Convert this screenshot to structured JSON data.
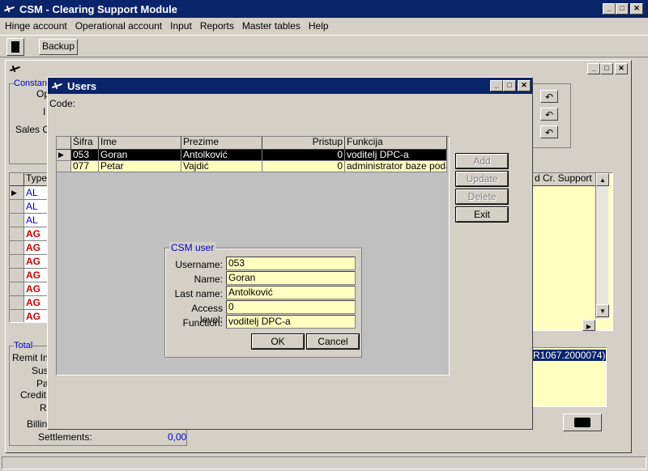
{
  "app": {
    "title": "CSM - Clearing Support Module",
    "menu": [
      "Hinge account",
      "Operational account",
      "Input",
      "Reports",
      "Master tables",
      "Help"
    ],
    "toolbar_backup_label": "Backup"
  },
  "bg_window": {
    "group_constants_label": "Constan",
    "label_op": "Op",
    "label_i": "I",
    "label_sales": "Sales C",
    "type_header": "Type",
    "type_rows": [
      {
        "v": "AL",
        "color": "#0000cc"
      },
      {
        "v": "AL",
        "color": "#0000cc"
      },
      {
        "v": "AL",
        "color": "#0000cc"
      },
      {
        "v": "AG",
        "color": "#cc0000"
      },
      {
        "v": "AG",
        "color": "#cc0000"
      },
      {
        "v": "AG",
        "color": "#cc0000"
      },
      {
        "v": "AG",
        "color": "#cc0000"
      },
      {
        "v": "AG",
        "color": "#cc0000"
      },
      {
        "v": "AG",
        "color": "#cc0000"
      },
      {
        "v": "AG",
        "color": "#cc0000"
      }
    ],
    "right_col_header": "d Cr. Support",
    "total_label": "Total",
    "remit_label": "Remit In",
    "sus_label": "Sus",
    "pa_label": "Pa",
    "credit_label": "Credit",
    "r_label": "R",
    "billing_label": "Billing",
    "settlements_label": "Settlements:",
    "settlements_value": "0,00",
    "right_info_text": "R1067.2000074)"
  },
  "users_window": {
    "title": "Users",
    "code_label": "Code:",
    "columns": [
      "Šifra",
      "Ime",
      "Prezime",
      "Pristup",
      "Funkcija"
    ],
    "rows": [
      {
        "sifra": "053",
        "ime": "Goran",
        "prezime": "Antolković",
        "pristup": "0",
        "funkcija": "voditelj DPC-a",
        "selected": true
      },
      {
        "sifra": "077",
        "ime": "Petar",
        "prezime": "Vajdić",
        "pristup": "0",
        "funkcija": "administrator baze podatal",
        "selected": false
      }
    ],
    "buttons": {
      "add": "Add",
      "update": "Update",
      "delete": "Delete",
      "exit": "Exit"
    },
    "csm_user": {
      "group_label": "CSM user",
      "username_label": "Username:",
      "username_value": "053",
      "name_label": "Name:",
      "name_value": "Goran",
      "lastname_label": "Last name:",
      "lastname_value": "Antolković",
      "access_label": "Access level:",
      "access_value": "0",
      "function_label": "Function:",
      "function_value": "voditelj DPC-a",
      "ok_label": "OK",
      "cancel_label": "Cancel"
    }
  }
}
